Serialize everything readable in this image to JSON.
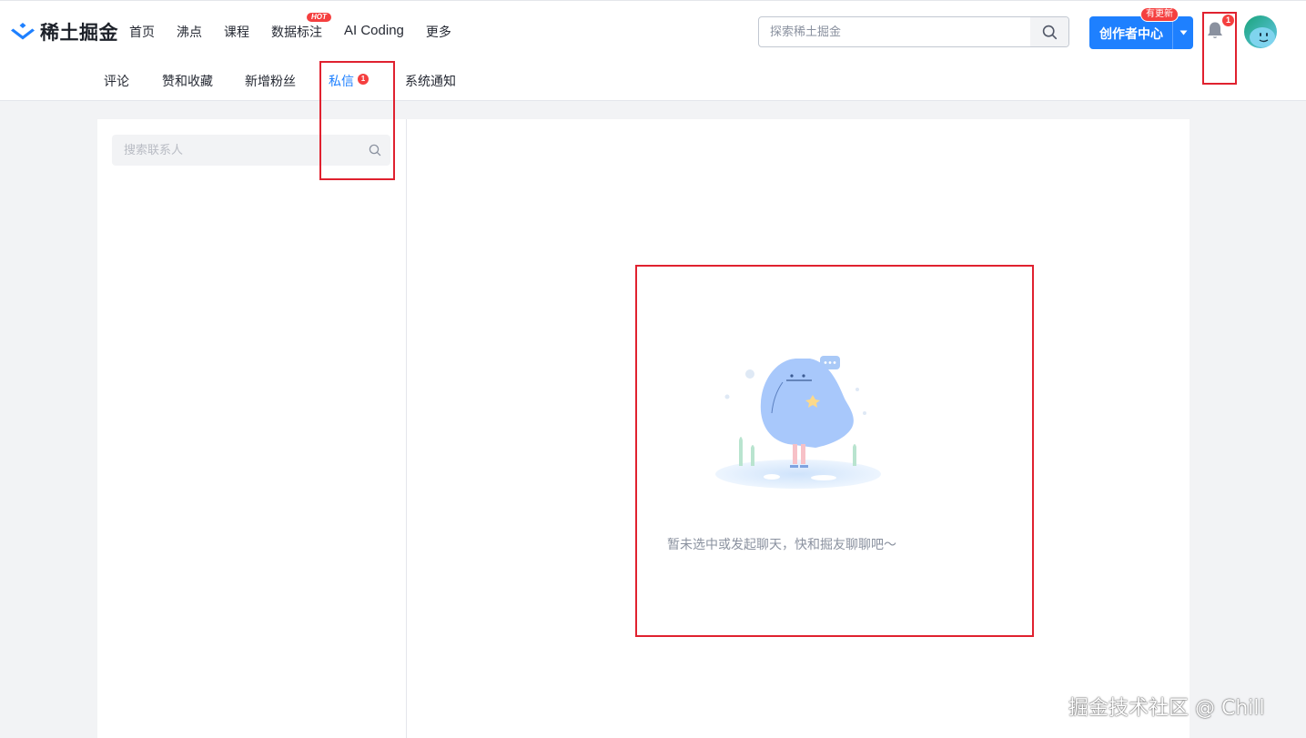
{
  "brand": {
    "name": "稀土掘金"
  },
  "nav": {
    "items": [
      {
        "label": "首页"
      },
      {
        "label": "沸点"
      },
      {
        "label": "课程"
      },
      {
        "label": "数据标注",
        "badge": "HOT"
      },
      {
        "label": "AI Coding"
      },
      {
        "label": "更多"
      }
    ]
  },
  "search": {
    "placeholder": "探索稀土掘金",
    "icon": "search-icon"
  },
  "creator": {
    "label": "创作者中心",
    "badge": "有更新",
    "menu_icon": "caret-down-icon"
  },
  "notifications": {
    "icon": "bell-icon",
    "count": "1"
  },
  "user": {
    "avatar_icon": "avatar-icon"
  },
  "subnav": {
    "items": [
      {
        "label": "评论"
      },
      {
        "label": "赞和收藏"
      },
      {
        "label": "新增粉丝"
      },
      {
        "label": "私信",
        "count": "1",
        "active": true
      },
      {
        "label": "系统通知"
      }
    ]
  },
  "contacts": {
    "search_placeholder": "搜索联系人",
    "icon": "search-icon"
  },
  "chat": {
    "empty_message": "暂未选中或发起聊天，快和掘友聊聊吧～",
    "illustration": "empty-chat-illustration"
  },
  "watermark": "掘金技术社区 @ Chill",
  "colors": {
    "accent": "#1e80ff",
    "badge": "#f53f3f",
    "page_background": "#f2f3f5",
    "highlight_box": "#e0212f"
  }
}
